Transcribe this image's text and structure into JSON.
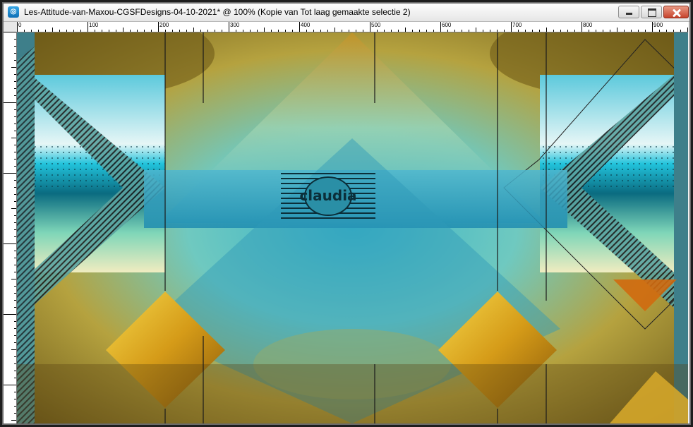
{
  "window": {
    "title": "Les-Attitude-van-Maxou-CGSFDesigns-04-10-2021* @ 100% (Kopie van Tot laag gemaakte selectie 2)",
    "app_icon": "paintshop-pro-icon",
    "buttons": {
      "minimize": "minimize-icon",
      "maximize": "maximize-icon",
      "close": "close-icon"
    }
  },
  "ruler": {
    "horizontal_labels": [
      "0",
      "100",
      "200",
      "300",
      "400",
      "500",
      "600",
      "700",
      "800",
      "900"
    ]
  },
  "canvas": {
    "watermark_text": "claudia",
    "colors": {
      "teal": "#1a8fa8",
      "gold": "#d9a21c",
      "amber": "#b8721a",
      "cyan": "#3fd0dc",
      "cream": "#f2e49a"
    }
  }
}
